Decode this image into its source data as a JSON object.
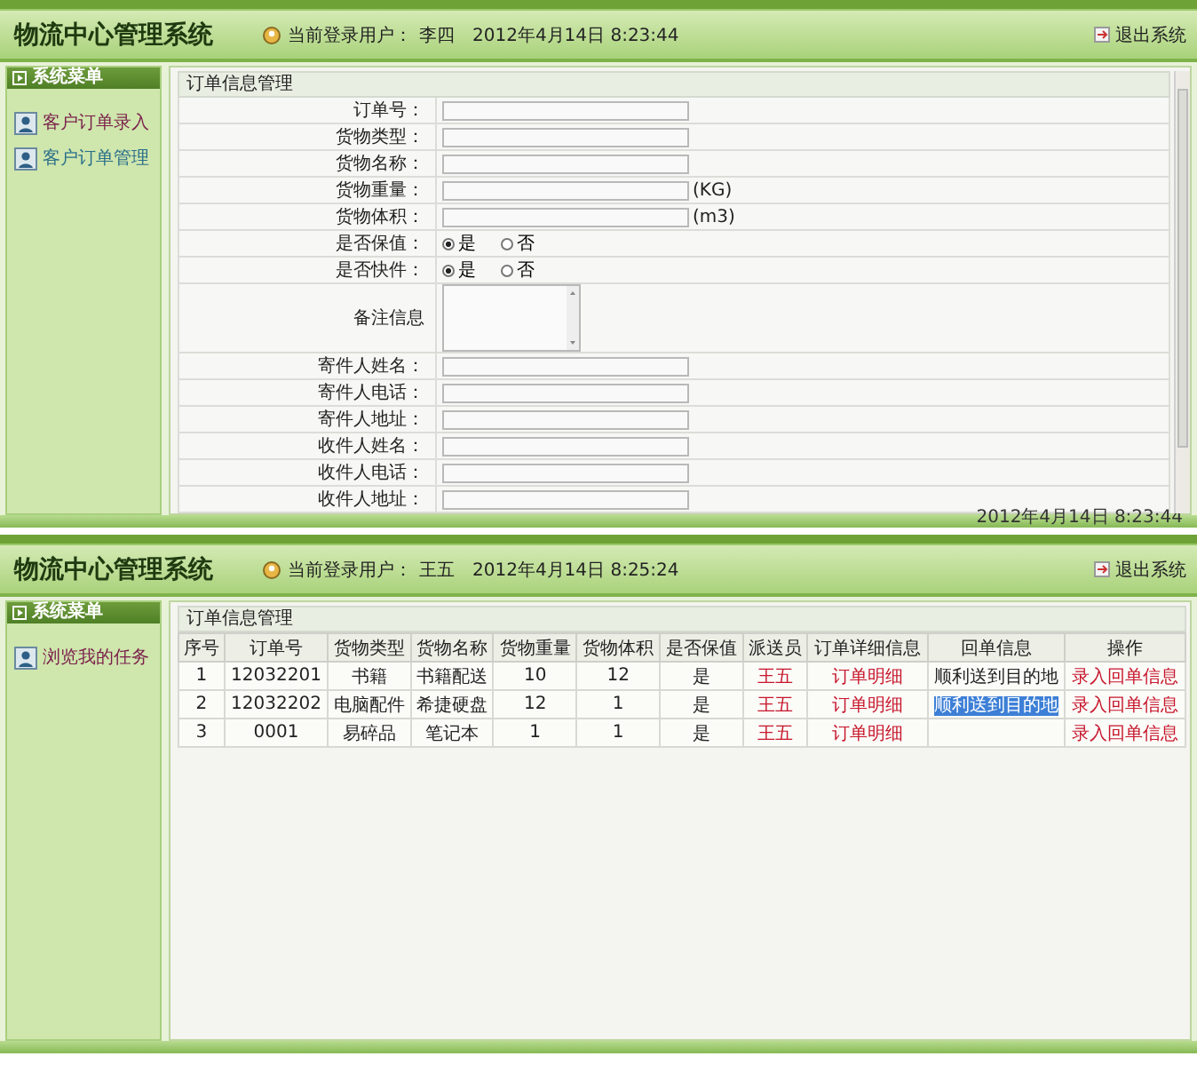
{
  "screens": [
    {
      "kind": "form",
      "header": {
        "title": "物流中心管理系统",
        "user_label": "当前登录用户：",
        "user": "李四",
        "datetime": "2012年4月14日  8:23:44",
        "logout": "退出系统"
      },
      "sidebar": {
        "title": "系统菜单",
        "items": [
          {
            "label": "客户订单录入",
            "selected": true
          },
          {
            "label": "客户订单管理",
            "selected": false
          }
        ]
      },
      "panel_title": "订单信息管理",
      "fields": [
        {
          "kind": "text",
          "label": "订单号："
        },
        {
          "kind": "text",
          "label": "货物类型："
        },
        {
          "kind": "text",
          "label": "货物名称："
        },
        {
          "kind": "text",
          "label": "货物重量：",
          "unit": "(KG)"
        },
        {
          "kind": "text",
          "label": "货物体积：",
          "unit": "(m3)"
        },
        {
          "kind": "radio",
          "label": "是否保值：",
          "options": [
            {
              "label": "是",
              "selected": true
            },
            {
              "label": "否",
              "selected": false
            }
          ]
        },
        {
          "kind": "radio",
          "label": "是否快件：",
          "options": [
            {
              "label": "是",
              "selected": true
            },
            {
              "label": "否",
              "selected": false
            }
          ]
        },
        {
          "kind": "textarea",
          "label": "备注信息"
        },
        {
          "kind": "text",
          "label": "寄件人姓名："
        },
        {
          "kind": "text",
          "label": "寄件人电话："
        },
        {
          "kind": "text",
          "label": "寄件人地址："
        },
        {
          "kind": "text",
          "label": "收件人姓名："
        },
        {
          "kind": "text",
          "label": "收件人电话："
        },
        {
          "kind": "text",
          "label": "收件人地址："
        }
      ],
      "status_bar": "2012年4月14日  8:23:44"
    },
    {
      "kind": "table",
      "header": {
        "title": "物流中心管理系统",
        "user_label": "当前登录用户：",
        "user": "王五",
        "datetime": "2012年4月14日  8:25:24",
        "logout": "退出系统"
      },
      "sidebar": {
        "title": "系统菜单",
        "items": [
          {
            "label": "浏览我的任务",
            "selected": true
          }
        ]
      },
      "panel_title": "订单信息管理",
      "table": {
        "columns": [
          "序号",
          "订单号",
          "货物类型",
          "货物名称",
          "货物重量",
          "货物体积",
          "是否保值",
          "派送员",
          "订单详细信息",
          "回单信息",
          "操作"
        ],
        "rows": [
          [
            {
              "kind": "text",
              "text": "1"
            },
            {
              "kind": "text",
              "text": "12032201"
            },
            {
              "kind": "text",
              "text": "书籍"
            },
            {
              "kind": "text",
              "text": "书籍配送"
            },
            {
              "kind": "text",
              "text": "10"
            },
            {
              "kind": "text",
              "text": "12"
            },
            {
              "kind": "text",
              "text": "是"
            },
            {
              "kind": "link",
              "text": "王五"
            },
            {
              "kind": "link",
              "text": "订单明细"
            },
            {
              "kind": "text",
              "text": "顺利送到目的地"
            },
            {
              "kind": "link",
              "text": "录入回单信息"
            }
          ],
          [
            {
              "kind": "text",
              "text": "2"
            },
            {
              "kind": "text",
              "text": "12032202"
            },
            {
              "kind": "text",
              "text": "电脑配件"
            },
            {
              "kind": "text",
              "text": "希捷硬盘"
            },
            {
              "kind": "text",
              "text": "12"
            },
            {
              "kind": "text",
              "text": "1"
            },
            {
              "kind": "text",
              "text": "是"
            },
            {
              "kind": "link",
              "text": "王五"
            },
            {
              "kind": "link",
              "text": "订单明细"
            },
            {
              "kind": "highlight",
              "text": "顺利送到目的地"
            },
            {
              "kind": "link",
              "text": "录入回单信息"
            }
          ],
          [
            {
              "kind": "text",
              "text": "3"
            },
            {
              "kind": "text",
              "text": "0001"
            },
            {
              "kind": "text",
              "text": "易碎品"
            },
            {
              "kind": "text",
              "text": "笔记本"
            },
            {
              "kind": "text",
              "text": "1"
            },
            {
              "kind": "text",
              "text": "1"
            },
            {
              "kind": "text",
              "text": "是"
            },
            {
              "kind": "link",
              "text": "王五"
            },
            {
              "kind": "link",
              "text": "订单明细"
            },
            {
              "kind": "empty"
            },
            {
              "kind": "link",
              "text": "录入回单信息"
            }
          ]
        ]
      }
    }
  ]
}
